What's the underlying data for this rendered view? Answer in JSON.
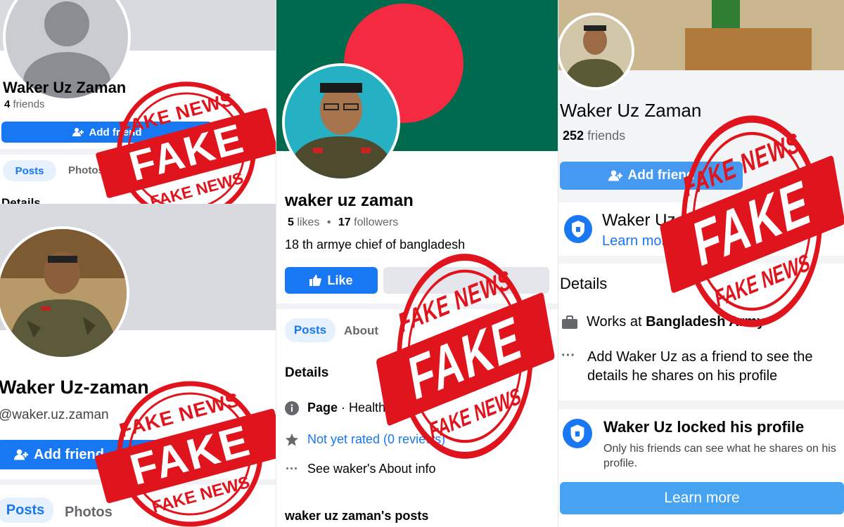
{
  "stamp": {
    "top": "FAKE NEWS",
    "word": "FAKE",
    "bottom": "FAKE NEWS",
    "color": "#e0141d"
  },
  "p1": {
    "name": "Waker Uz Zaman",
    "friends_count": "4",
    "friends_label": "friends",
    "add_friend": "Add friend",
    "tab_posts": "Posts",
    "tab_photos": "Photos",
    "details": "Details"
  },
  "p2": {
    "name": "Waker Uz-zaman",
    "handle": "@waker.uz.zaman",
    "add_friend": "Add friend",
    "tab_posts": "Posts",
    "tab_photos": "Photos"
  },
  "p3": {
    "name": "waker uz zaman",
    "likes_count": "5",
    "likes_label": "likes",
    "sep": "•",
    "followers_count": "17",
    "followers_label": "followers",
    "bio": "18 th armye chief of bangladesh",
    "like_button": "Like",
    "tab_posts": "Posts",
    "tab_about": "About",
    "details": "Details",
    "page_label": "Page",
    "page_category": "· Health",
    "rating": "Not yet rated (0 reviews)",
    "see_about": "See waker's About info",
    "posts_heading": "waker uz zaman's posts",
    "colors": {
      "flag_green": "#006a4e",
      "flag_red": "#f42a41"
    }
  },
  "p4": {
    "name": "Waker Uz Zaman",
    "friends_count": "252",
    "friends_label": "friends",
    "add_friend": "Add friend",
    "lock_title_short": "Waker Uz",
    "learn_more_short": "Learn more",
    "details": "Details",
    "works_prefix": "Works at",
    "works_at": "Bangladesh Army",
    "add_friend_info": "Add Waker Uz as a friend to see the details he shares on his profile",
    "locked_title": "Waker Uz locked his profile",
    "locked_desc": "Only his friends can see what he shares on his profile.",
    "learn_more": "Learn more"
  }
}
